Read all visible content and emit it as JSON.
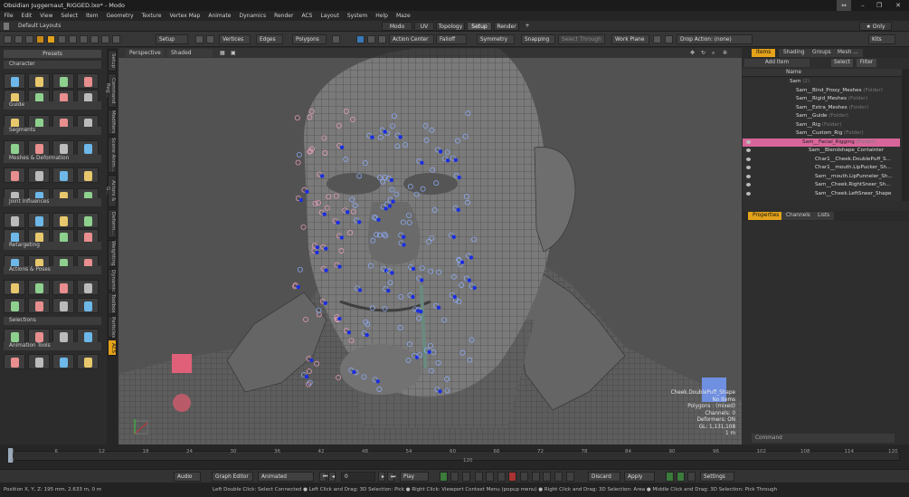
{
  "window": {
    "title": "Obsidian Juggernaut_RIGGED.lxo* - Modo",
    "controls": [
      "⇔",
      "–",
      "❐",
      "✕"
    ]
  },
  "menu": [
    "File",
    "Edit",
    "View",
    "Select",
    "Item",
    "Geometry",
    "Texture",
    "Vertex Map",
    "Animate",
    "Dynamics",
    "Render",
    "ACS",
    "Layout",
    "System",
    "Help",
    "Maze"
  ],
  "modebar": {
    "layout": "Default Layouts",
    "tabs": [
      "Modo",
      "UV",
      "Topology",
      "Setup",
      "Render"
    ],
    "active": "Setup",
    "add": "+",
    "only": "★ Only"
  },
  "toolbar": {
    "setup": "Setup",
    "vertices": "Vertices",
    "edges": "Edges",
    "polygons": "Polygons",
    "action_center": "Action Center",
    "falloff": "Falloff",
    "symmetry": "Symmetry",
    "snapping": "Snapping",
    "select_through": "Select Through",
    "work_plane": "Work Plane",
    "drop_action": "Drop Action: (none)",
    "kits": "Kits"
  },
  "left_panel": {
    "presets": "Presets",
    "sections": [
      "Character",
      "Guide",
      "Segments",
      "Meshes & Deformation",
      "Joint Influences",
      "Retargeting",
      "Actions & Poses",
      "Selections",
      "Animation Tools"
    ],
    "vtabs": [
      "Setup",
      "Command Reg...",
      "Modifiers",
      "Scene Anim...",
      "Actors & G...",
      "Deform...",
      "Weighting",
      "Dynamics",
      "Toolbox",
      "Particles",
      "ACS"
    ]
  },
  "viewport": {
    "view": "Perspective",
    "shading": "Shaded",
    "hud": [
      "Cheek.DoublePuff_Shape",
      "No Items",
      "Polygons : (mixed)",
      "Channels: 0",
      "Deformers: ON",
      "GL: 1,131,108",
      "1 m"
    ]
  },
  "right_panel": {
    "tabs": [
      "Items",
      "Shading",
      "Groups",
      "Mesh ..."
    ],
    "add_item": "Add Item",
    "select": "Select",
    "filter": "Filter",
    "column_name": "Name",
    "tree": [
      {
        "label": "Sam",
        "type": "(2)",
        "indent": 0
      },
      {
        "label": "Sam__Bind_Proxy_Meshes",
        "type": "(Folder)",
        "indent": 1
      },
      {
        "label": "Sam__Rigid_Meshes",
        "type": "(Folder)",
        "indent": 1
      },
      {
        "label": "Sam__Extra_Meshes",
        "type": "(Folder)",
        "indent": 1
      },
      {
        "label": "Sam__Guide",
        "type": "(Folder)",
        "indent": 1
      },
      {
        "label": "Sam__Rig",
        "type": "(Folder)",
        "indent": 1
      },
      {
        "label": "Sam__Custom_Rig",
        "type": "(Folder)",
        "indent": 1
      },
      {
        "label": "Sam__Facial_Rigging",
        "type": "(Folder)",
        "indent": 2,
        "selected": true
      },
      {
        "label": "Sam__Blendshape_Containter",
        "type": "",
        "indent": 3
      },
      {
        "label": "Char1__Cheek.DoublePuff_S...",
        "type": "",
        "indent": 4
      },
      {
        "label": "Char1__mouth.LipPucker_Sh...",
        "type": "",
        "indent": 4
      },
      {
        "label": "Sam__mouth.LipFunneler_Sh...",
        "type": "",
        "indent": 4
      },
      {
        "label": "Sam__Cheek.RightSneer_Sh...",
        "type": "",
        "indent": 4
      },
      {
        "label": "Sam__Cheek.LeftSneer_Shape",
        "type": "",
        "indent": 4
      }
    ],
    "lower_tabs": [
      "Properties",
      "Channels",
      "Lists"
    ],
    "command": "Command"
  },
  "timeline": {
    "ticks": [
      "0",
      "6",
      "12",
      "18",
      "24",
      "30",
      "36",
      "42",
      "48",
      "54",
      "60",
      "66",
      "72",
      "78",
      "84",
      "90",
      "96",
      "102",
      "108",
      "114",
      "120"
    ],
    "lower_ticks": [
      "0",
      "120"
    ]
  },
  "transport": {
    "audio": "Audio",
    "graph_editor": "Graph Editor",
    "animated": "Animated",
    "frame": "0",
    "play": "Play",
    "discard": "Discard",
    "apply": "Apply",
    "settings": "Settings"
  },
  "status": {
    "position": "Position X, Y, Z:   195 mm, 2.633 m, 0 m",
    "hint": "Left Double Click: Select Connected ● Left Click and Drag: 3D Selection: Pick ● Right Click: Viewport Context Menu (popup menu) ● Right Click and Drag: 3D Selection: Area ● Middle Click and Drag: 3D Selection: Pick Through"
  },
  "colors": {
    "accent": "#e3a21a",
    "selected_row": "#d9669a",
    "viewport_bg": "#525252"
  }
}
